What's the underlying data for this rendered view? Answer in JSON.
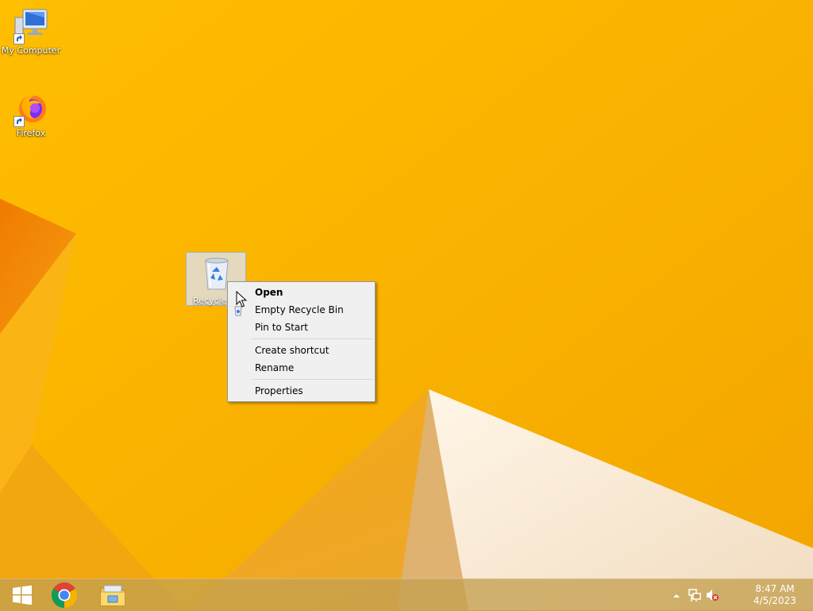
{
  "desktop": {
    "icons": [
      {
        "label": "My Computer"
      },
      {
        "label": "Firefox"
      },
      {
        "label": "Recycle"
      }
    ]
  },
  "context_menu": {
    "items": [
      {
        "label": "Open",
        "bold": true
      },
      {
        "label": "Empty Recycle Bin"
      },
      {
        "label": "Pin to Start"
      },
      {
        "label": "Create shortcut"
      },
      {
        "label": "Rename"
      },
      {
        "label": "Properties"
      }
    ]
  },
  "taskbar": {
    "pinned": [
      "start-icon",
      "chrome-icon",
      "file-explorer-icon"
    ]
  },
  "tray": {
    "time": "8:47 AM",
    "date": "4/5/2023",
    "icons": [
      "show-hidden-icons-icon",
      "network-icon",
      "volume-muted-icon"
    ]
  },
  "colors": {
    "wallpaper": "#f7b300",
    "accent_orange": "#f08a00",
    "taskbar": "#c4a050"
  }
}
